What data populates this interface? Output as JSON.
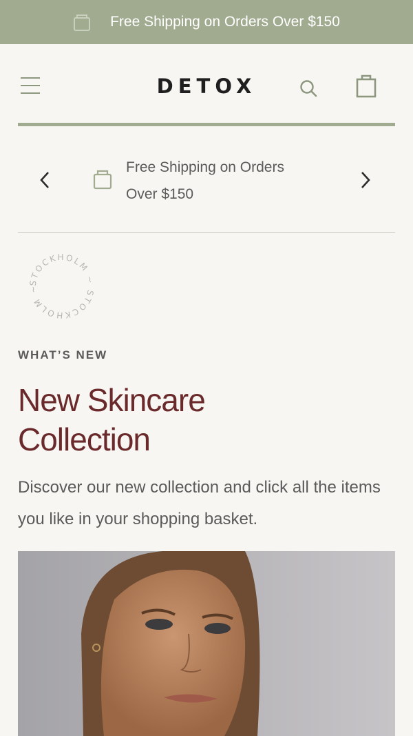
{
  "promo": {
    "text": "Free Shipping on Orders Over $150",
    "icon": "shopping-bag-icon"
  },
  "header": {
    "logo": "DETOX",
    "menu_icon": "hamburger-menu-icon",
    "search_icon": "search-icon",
    "bag_icon": "shopping-bag-icon"
  },
  "carousel": {
    "message_line1": "Free Shipping on Orders",
    "message_line2": "Over $150",
    "prev_icon": "chevron-left-icon",
    "next_icon": "chevron-right-icon"
  },
  "stamp": {
    "text": "STOCKHOLM ~ STOCKHOLM ~"
  },
  "section": {
    "eyebrow": "WHAT’S NEW",
    "headline_line1": "New Skincare",
    "headline_line2": "Collection",
    "body": "Discover our new collection and click all the items you like in your shopping basket."
  },
  "colors": {
    "accent": "#a1ab90",
    "headline": "#6a2a2c",
    "background": "#f8f6f2"
  }
}
